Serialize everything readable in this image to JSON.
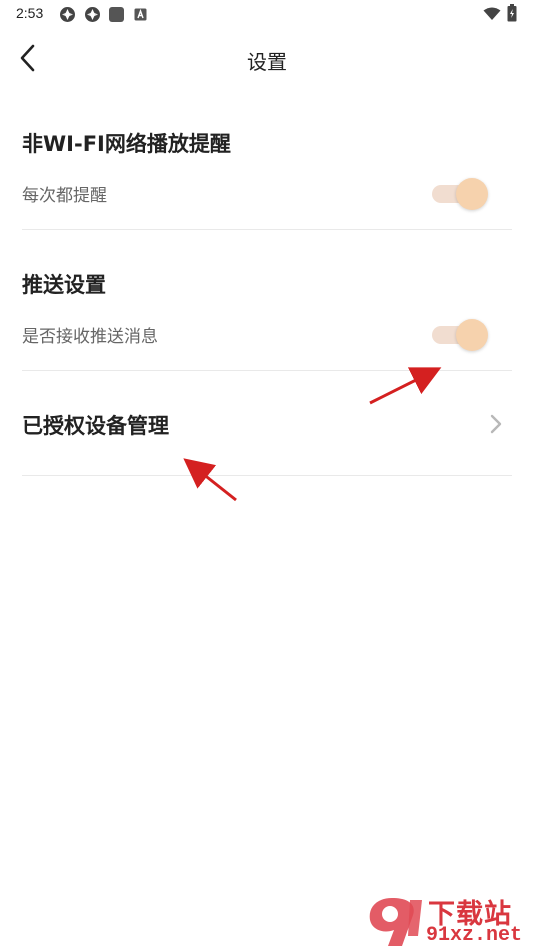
{
  "status_bar": {
    "time": "2:53",
    "icons": [
      "app-icon-1",
      "app-icon-2",
      "app-icon-3",
      "app-icon-4",
      "wifi-icon",
      "battery-icon"
    ]
  },
  "header": {
    "title": "设置",
    "back_icon": "chevron-left-icon"
  },
  "sections": {
    "wifi_reminder": {
      "title": "非WI-FI网络播放提醒",
      "desc": "每次都提醒",
      "toggle_on": true
    },
    "push_settings": {
      "title": "推送设置",
      "desc": "是否接收推送消息",
      "toggle_on": true
    },
    "authorized_devices": {
      "title": "已授权设备管理",
      "chevron_icon": "chevron-right-icon"
    }
  },
  "colors": {
    "toggle_track": "#f1ddd0",
    "toggle_thumb": "#f6d2ad",
    "divider": "#e9e9e9",
    "annotation_arrow": "#d42020",
    "watermark": "#d9373f"
  },
  "watermark": {
    "cn": "下载站",
    "url": "91xz.net"
  }
}
